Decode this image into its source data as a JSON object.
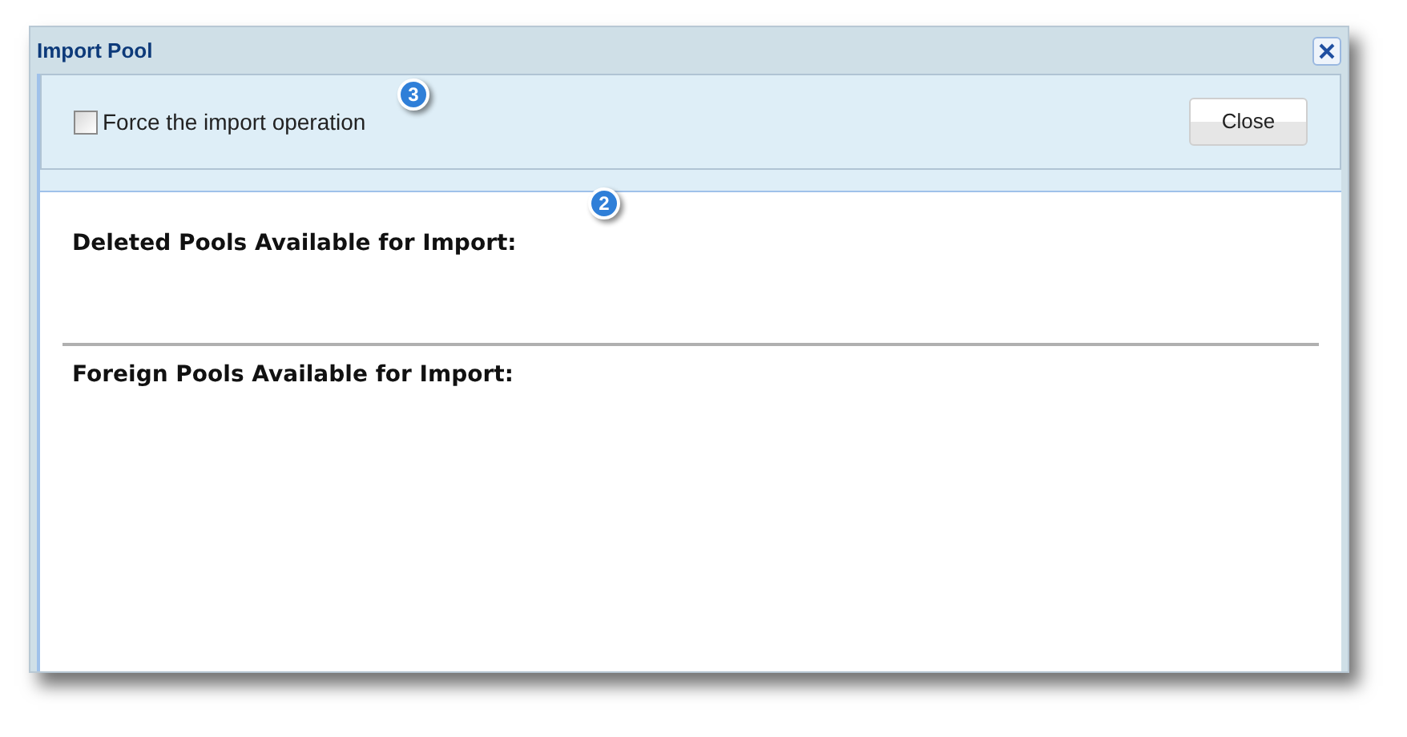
{
  "window": {
    "title": "Import Pool"
  },
  "force_option": {
    "label": "Force the import operation",
    "checked": false
  },
  "close_button": {
    "label": "Close"
  },
  "sections": [
    {
      "heading": "Deleted Pools Available for Import:"
    },
    {
      "heading": "Foreign Pools Available for Import:"
    }
  ],
  "callouts": [
    {
      "number": "3"
    },
    {
      "number": "2"
    }
  ]
}
